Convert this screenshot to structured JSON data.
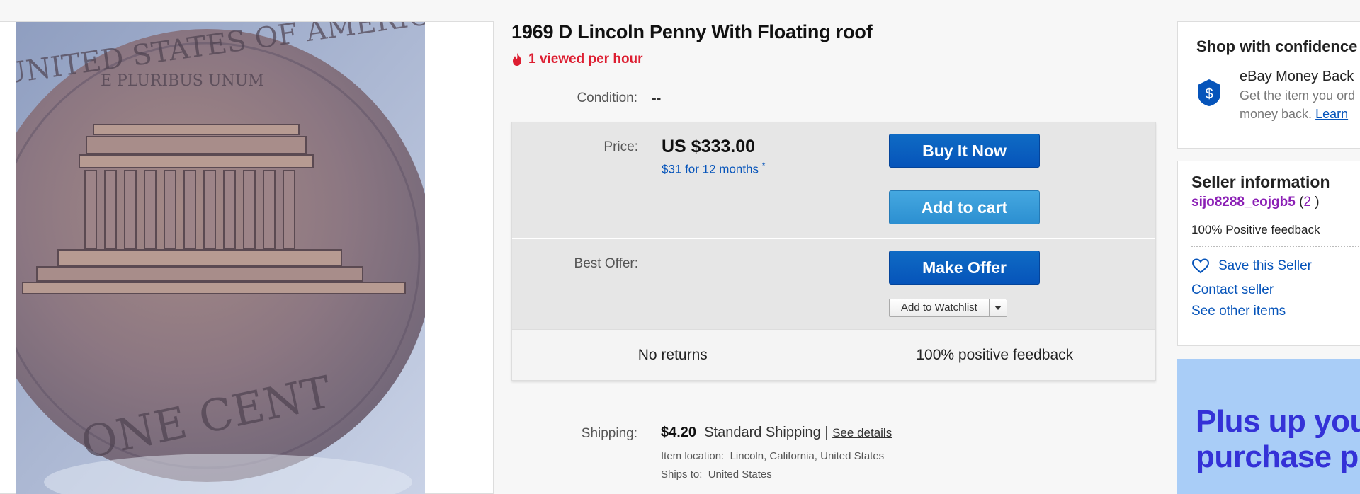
{
  "listing": {
    "title": "1969 D Lincoln Penny With Floating roof",
    "activity": "1 viewed per hour",
    "condition_label": "Condition:",
    "condition_value": "--"
  },
  "coin_image": {
    "top_text": "UNITED STATES OF AMERICA",
    "motto": "E PLURIBUS UNUM",
    "bottom_text": "ONE CENT"
  },
  "price": {
    "label": "Price:",
    "value": "US $333.00",
    "financing": "$31 for 12 months",
    "financing_mark": "*"
  },
  "buttons": {
    "buy_now": "Buy It Now",
    "add_to_cart": "Add to cart",
    "make_offer": "Make Offer",
    "watchlist": "Add to Watchlist"
  },
  "best_offer": {
    "label": "Best Offer:"
  },
  "trust": {
    "returns": "No returns",
    "feedback": "100% positive feedback"
  },
  "shipping": {
    "label": "Shipping:",
    "cost": "$4.20",
    "method": "Standard Shipping",
    "separator": "|",
    "see_details": "See details",
    "location_label": "Item location:",
    "location": "Lincoln, California, United States",
    "ships_to_label": "Ships to:",
    "ships_to": "United States"
  },
  "confidence": {
    "heading": "Shop with confidence",
    "mbg_title": "eBay Money Back",
    "mbg_desc_1": "Get the item you ord",
    "mbg_desc_2": "money back.",
    "learn": "Learn"
  },
  "seller": {
    "heading": "Seller information",
    "username": "sijo8288_eojgb5",
    "score": "2",
    "feedback": "100% Positive feedback",
    "save": "Save this Seller",
    "contact": "Contact seller",
    "other_items": "See other items"
  },
  "promo": {
    "line1": "Plus up you",
    "line2": "purchase p"
  },
  "colors": {
    "primary_button": "#0654ba",
    "cart_button": "#2c8fd1",
    "link": "#0654ba",
    "urgency": "#dd1e31",
    "seller_name": "#8b1fb5",
    "promo_bg": "#a9cdf7",
    "promo_text": "#3431d7"
  }
}
